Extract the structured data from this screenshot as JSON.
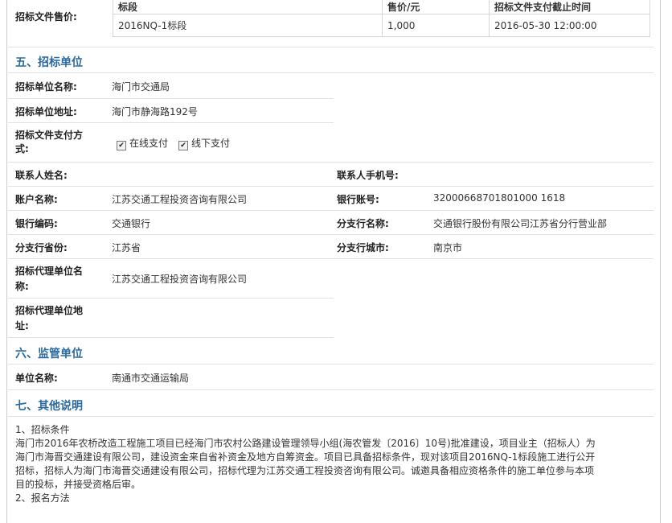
{
  "price_section": {
    "label": "招标文件售价:",
    "headers": [
      "标段",
      "售价/元",
      "招标文件支付截止时间"
    ],
    "row": [
      "2016NQ-1标段",
      "1,000",
      "2016-05-30 12:00:00"
    ]
  },
  "section5": {
    "title": "五、招标单位",
    "unit_name_label": "招标单位名称:",
    "unit_name": "海门市交通局",
    "unit_addr_label": "招标单位地址:",
    "unit_addr": "海门市静海路192号",
    "pay_label_1": "招标文件支付方",
    "pay_label_2": "式:",
    "pay_online": "在线支付",
    "pay_offline": "线下支付",
    "contact_label": "联系人姓名:",
    "contact_value": "",
    "phone_label": "联系人手机号:",
    "phone_value": "",
    "account_label": "账户名称:",
    "account_value": "江苏交通工程投资咨询有限公司",
    "bank_acc_label": "银行账号:",
    "bank_acc_value": "32000668701801000 1618",
    "bank_code_label": "银行编码:",
    "bank_code_value": "交通银行",
    "branch_label": "分支行名称:",
    "branch_value": "交通银行股份有限公司江苏省分行营业部",
    "province_label": "分支行省份:",
    "province_value": "江苏省",
    "city_label": "分支行城市:",
    "city_value": "南京市",
    "agent_name_label_1": "招标代理单位名",
    "agent_name_label_2": "称:",
    "agent_name_value": "江苏交通工程投资咨询有限公司",
    "agent_addr_label_1": "招标代理单位地",
    "agent_addr_label_2": "址:",
    "agent_addr_value": ""
  },
  "section6": {
    "title": "六、监管单位",
    "unit_label": "单位名称:",
    "unit_value": "南通市交通运输局"
  },
  "section7": {
    "title": "七、其他说明",
    "item1": "1、招标条件",
    "para1_l1": "海门市2016年农桥改造工程施工项目已经海门市农村公路建设管理领导小组(海农管发〔2016〕10号)批准建设，项目业主（招标人）为",
    "para1_l2": "海门市海晋交通建设有限公司，建设资金来自省补资金及地方自筹资金。项目已具备招标条件，现对该项目2016NQ-1标段施工进行公开",
    "para1_l3": "招标，招标人为海门市海晋交通建设有限公司，招标代理为江苏交通工程投资咨询有限公司。诚邀具备相应资格条件的施工单位参与本项",
    "para1_l4": "目的投标，并接受资格后审。",
    "item2": "2、报名方法"
  }
}
